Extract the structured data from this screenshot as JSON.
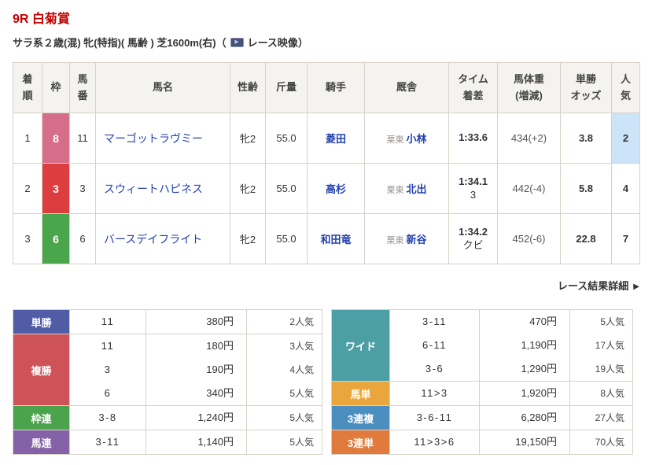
{
  "icons": {
    "arrow_right": "▶",
    "play": "▶"
  },
  "colors": {
    "title_red": "#c00000",
    "link_blue": "#2442ae",
    "frame_8_pink": "#d76e89",
    "frame_3_red": "#dc3e3f",
    "frame_6_green": "#4aa64a",
    "popularity_highlight_blue": "#cde3f8",
    "tansho_blue": "#505ca6",
    "fukusho_red": "#ce5358",
    "wakuren_green": "#4ba44b",
    "umaren_purple": "#8561a8",
    "wide_teal": "#4d9fa6",
    "umatan_amber": "#e8a63c",
    "sanrenpuku_blue": "#4b8fc0",
    "sanrentan_orange": "#e07b3d"
  },
  "header": {
    "race_title": "9R 白菊賞",
    "race_conditions": "サラ系２歳(混) 牝(特指)( 馬齢 ) 芝1600m(右)",
    "paren_open": "（",
    "video_link_label": "レース映像",
    "paren_close": "）"
  },
  "results_table": {
    "columns": {
      "finish": "着\n順",
      "frame": "枠",
      "horse_number": "馬\n番",
      "horse_name": "馬名",
      "sex_age": "性齢",
      "weight": "斤量",
      "jockey": "騎手",
      "stable": "厩舎",
      "time_margin": "タイム\n着差",
      "horse_weight": "馬体重\n(増減)",
      "odds": "単勝\nオッズ",
      "popularity": "人\n気"
    },
    "rows": [
      {
        "finish": "1",
        "frame": "8",
        "frame_color": "#d76e89",
        "horse_number": "11",
        "horse_name": "マーゴットラヴミー",
        "sex_age": "牝2",
        "weight_carried": "55.0",
        "jockey": "菱田",
        "stable_region": "栗東",
        "stable": "小林",
        "time": "1:33.6",
        "margin": "",
        "horse_weight": "434(+2)",
        "odds": "3.8",
        "popularity": "2",
        "popularity_bg": "#cde3f8"
      },
      {
        "finish": "2",
        "frame": "3",
        "frame_color": "#dc3e3f",
        "horse_number": "3",
        "horse_name": "スウィートハピネス",
        "sex_age": "牝2",
        "weight_carried": "55.0",
        "jockey": "高杉",
        "stable_region": "栗東",
        "stable": "北出",
        "time": "1:34.1",
        "margin": "3",
        "horse_weight": "442(-4)",
        "odds": "5.8",
        "popularity": "4"
      },
      {
        "finish": "3",
        "frame": "6",
        "frame_color": "#4aa64a",
        "horse_number": "6",
        "horse_name": "バースデイフライト",
        "sex_age": "牝2",
        "weight_carried": "55.0",
        "jockey": "和田竜",
        "stable_region": "栗東",
        "stable": "新谷",
        "time": "1:34.2",
        "margin": "クビ",
        "horse_weight": "452(-6)",
        "odds": "22.8",
        "popularity": "7"
      }
    ]
  },
  "detail_link": {
    "label": "レース結果詳細"
  },
  "payouts": {
    "left": {
      "tansho": {
        "type": "単勝",
        "color": "#505ca6",
        "combos": "11",
        "amounts": "380円",
        "popularity": "2人気"
      },
      "fukusho": {
        "type": "複勝",
        "color": "#ce5358",
        "combos": "11\n3\n6",
        "amounts": "180円\n190円\n340円",
        "popularity": "3人気\n4人気\n5人気"
      },
      "wakuren": {
        "type": "枠連",
        "color": "#4ba44b",
        "combos": "3-8",
        "amounts": "1,240円",
        "popularity": "5人気"
      },
      "umaren": {
        "type": "馬連",
        "color": "#8561a8",
        "combos": "3-11",
        "amounts": "1,140円",
        "popularity": "5人気"
      }
    },
    "right": {
      "wide": {
        "type": "ワイド",
        "color": "#4d9fa6",
        "combos": "3-11\n6-11\n3-6",
        "amounts": "470円\n1,190円\n1,290円",
        "popularity": "5人気\n17人気\n19人気"
      },
      "umatan": {
        "type": "馬単",
        "color": "#e8a63c",
        "combos": "11>3",
        "amounts": "1,920円",
        "popularity": "8人気"
      },
      "sanrenpuku": {
        "type": "3連複",
        "color": "#4b8fc0",
        "combos": "3-6-11",
        "amounts": "6,280円",
        "popularity": "27人気"
      },
      "sanrentan": {
        "type": "3連単",
        "color": "#e07b3d",
        "combos": "11>3>6",
        "amounts": "19,150円",
        "popularity": "70人気"
      }
    }
  }
}
